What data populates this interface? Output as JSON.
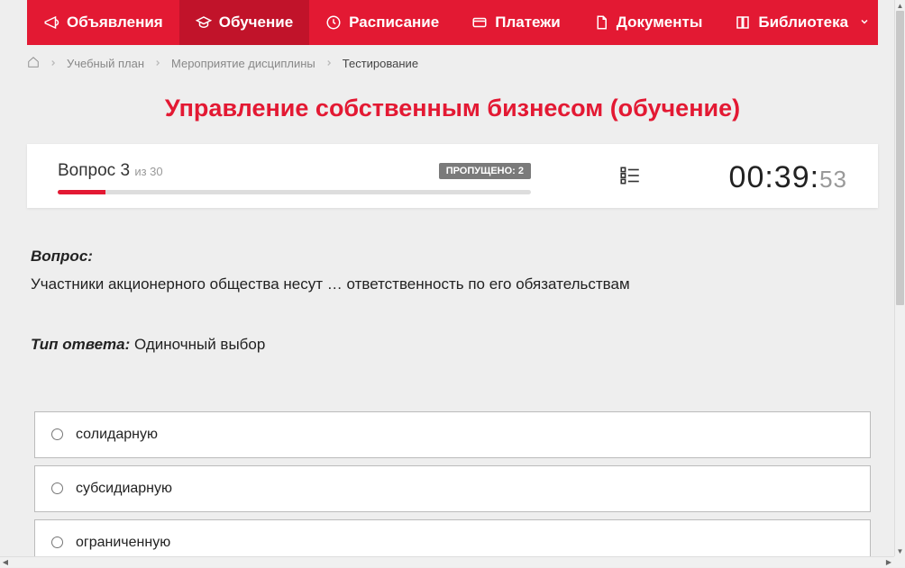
{
  "nav": {
    "items": [
      {
        "label": "Объявления",
        "icon": "megaphone"
      },
      {
        "label": "Обучение",
        "icon": "cap",
        "active": true
      },
      {
        "label": "Расписание",
        "icon": "clock"
      },
      {
        "label": "Платежи",
        "icon": "card"
      },
      {
        "label": "Документы",
        "icon": "doc"
      },
      {
        "label": "Библиотека",
        "icon": "book",
        "dropdown": true
      }
    ]
  },
  "breadcrumb": {
    "items": [
      "Учебный план",
      "Мероприятие дисциплины"
    ],
    "current": "Тестирование"
  },
  "page_title": "Управление собственным бизнесом (обучение)",
  "quiz": {
    "question_label": "Вопрос",
    "question_num": "3",
    "total_prefix": "из",
    "total": "30",
    "skipped_label": "ПРОПУЩЕНО: 2",
    "progress_pct": 10,
    "timer_main": "00:39:",
    "timer_sec": "53"
  },
  "question": {
    "label": "Вопрос:",
    "text": "Участники акционерного общества несут … ответственность по его обязательствам",
    "type_label": "Тип ответа:",
    "type_value": "Одиночный выбор"
  },
  "answers": [
    {
      "text": "солидарную"
    },
    {
      "text": "субсидиарную"
    },
    {
      "text": "ограниченную"
    }
  ]
}
